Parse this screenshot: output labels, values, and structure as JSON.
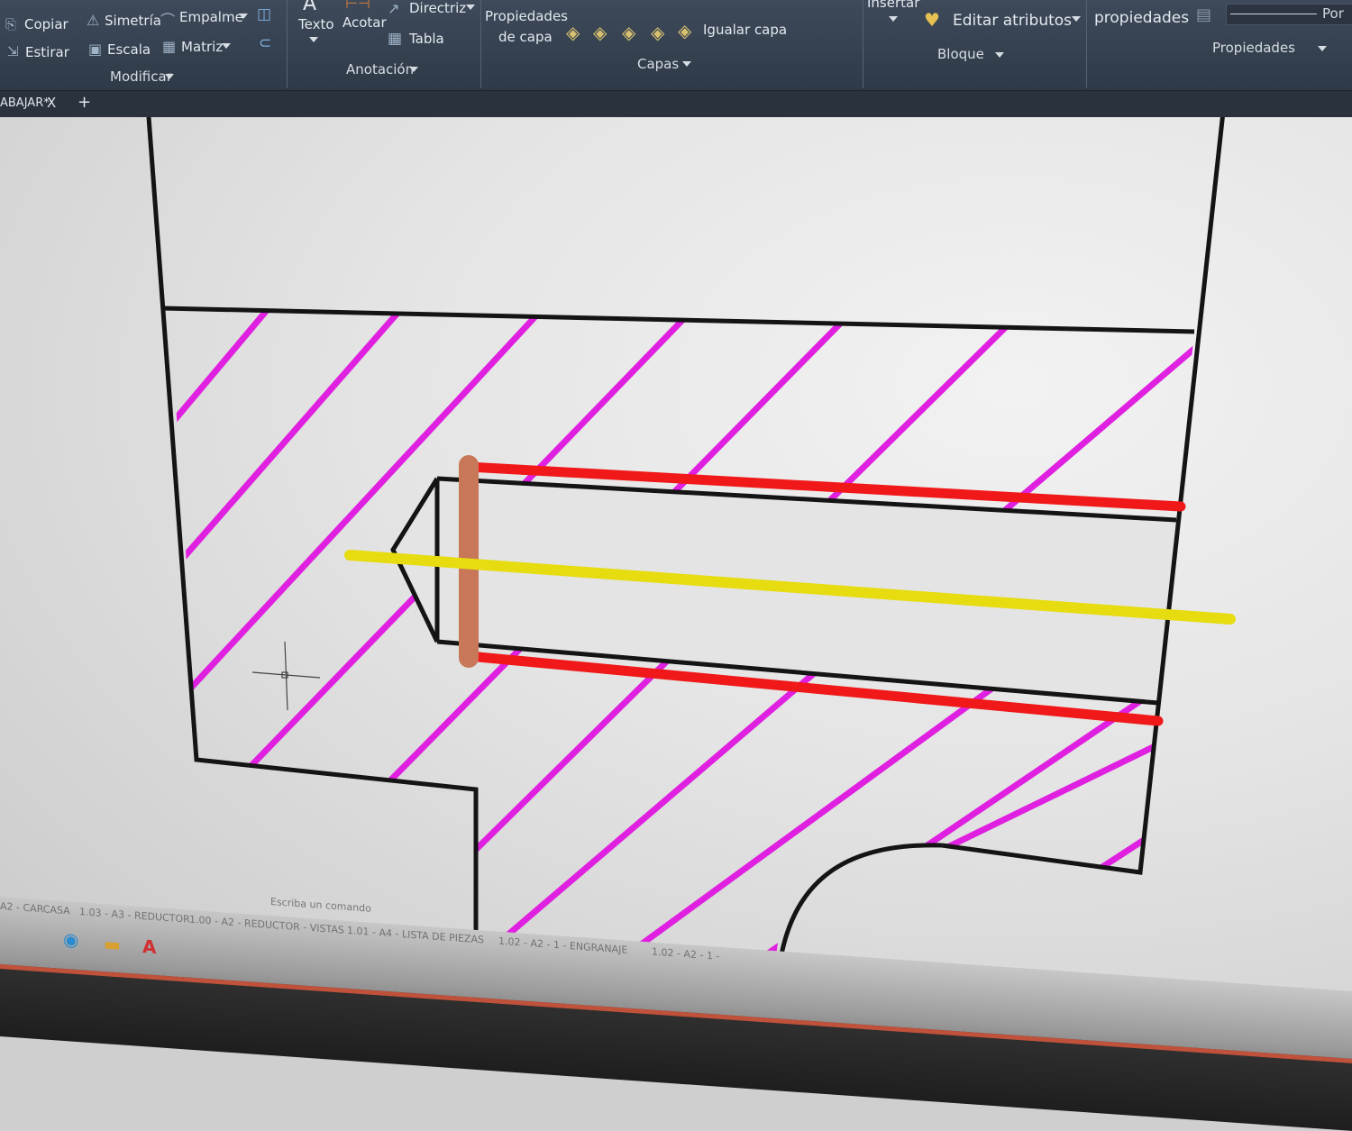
{
  "ribbon": {
    "modificar": {
      "copiar": "Copiar",
      "estirar": "Estirar",
      "simetria": "Simetría",
      "escala": "Escala",
      "empalme": "Empalme",
      "matriz": "Matriz",
      "panel": "Modificar"
    },
    "anotacion": {
      "texto": "Texto",
      "acotar": "Acotar",
      "directriz": "Directriz",
      "tabla": "Tabla",
      "panel": "Anotación"
    },
    "capas": {
      "propiedades_1": "Propiedades",
      "propiedades_2": "de capa",
      "igualar": "Igualar capa",
      "panel": "Capas"
    },
    "bloque": {
      "insertar": "Insertar",
      "editar": "Editar atributos",
      "panel": "Bloque"
    },
    "propiedades": {
      "igualar_prop": "propiedades",
      "por": "Por",
      "panel": "Propiedades"
    }
  },
  "tabs": {
    "drawing_tab": "ABAJAR*",
    "close": "X",
    "add": "+"
  },
  "layouts": {
    "items": [
      "A2 - CARCASA",
      "1.03 - A3 - REDUCTOR",
      "1.00 - A2 - REDUCTOR - VISTAS",
      "1.01 - A4 - LISTA DE PIEZAS",
      "1.02 - A2 - 1 - ENGRANAJE",
      "1.02 - A2 - 1 -"
    ],
    "command_placeholder": "Escriba un comando"
  },
  "colors": {
    "hatch": "#e020e0",
    "red": "#f01818",
    "yellow": "#e6dc10",
    "bottom_edge": "#c87858",
    "outline": "#141414"
  },
  "icons": [
    "copy-icon",
    "stretch-icon",
    "mirror-icon",
    "scale-icon",
    "fillet-icon",
    "array-icon",
    "text-icon",
    "dimension-icon",
    "leader-icon",
    "table-icon",
    "layer-icon",
    "edit-attributes-icon",
    "crosshair-cursor",
    "edge-browser-icon",
    "file-explorer-icon",
    "autocad-icon"
  ]
}
